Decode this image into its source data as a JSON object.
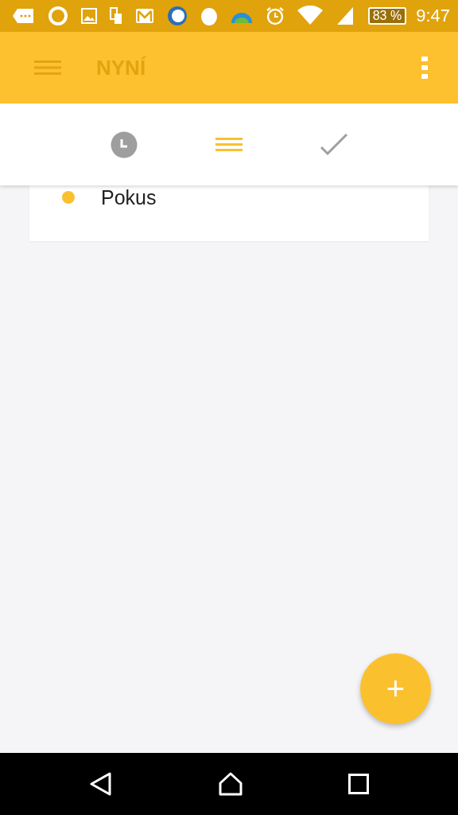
{
  "status_bar": {
    "battery": "83 %",
    "time": "9:47"
  },
  "app_bar": {
    "title": "NYNÍ"
  },
  "tabs": [
    {
      "kind": "clock",
      "selected": false
    },
    {
      "kind": "list",
      "selected": true
    },
    {
      "kind": "check",
      "selected": false
    }
  ],
  "tasks": [
    {
      "title": "Pokus",
      "color": "#fbc02d"
    }
  ],
  "fab": {
    "label": "+"
  }
}
